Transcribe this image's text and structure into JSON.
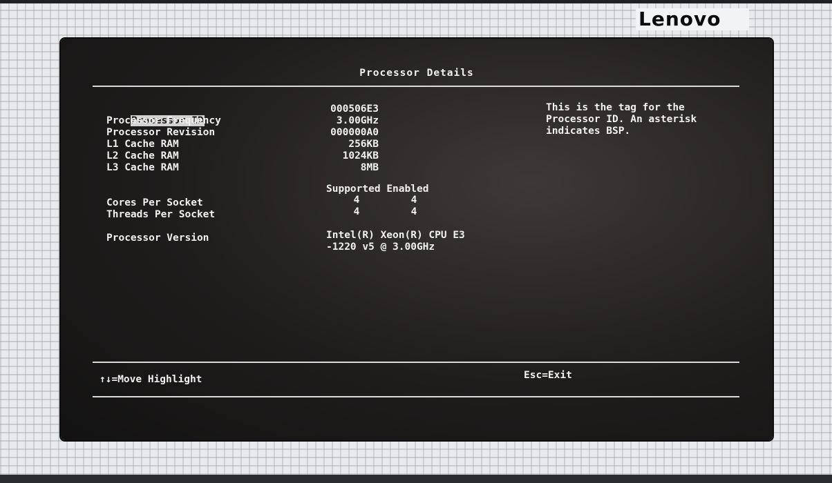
{
  "brand": {
    "logo_text": "Lenovo"
  },
  "screen": {
    "title": "Processor Details",
    "fields": [
      {
        "label": "Processor ID",
        "value": "000506E3"
      },
      {
        "label": "Processor Frequency",
        "value": "3.00GHz"
      },
      {
        "label": "Processor Revision",
        "value": "000000A0"
      },
      {
        "label": "L1 Cache RAM",
        "value": "256KB"
      },
      {
        "label": "L2 Cache RAM",
        "value": "1024KB"
      },
      {
        "label": "L3 Cache RAM",
        "value": "8MB"
      }
    ],
    "counts": {
      "header_supported": "Supported",
      "header_enabled": "Enabled",
      "rows": [
        {
          "label": "Cores Per Socket",
          "supported": "4",
          "enabled": "4"
        },
        {
          "label": "Threads Per Socket",
          "supported": "4",
          "enabled": "4"
        }
      ]
    },
    "version": {
      "label": "Processor Version",
      "line1": "Intel(R) Xeon(R) CPU E3",
      "line2": "-1220 v5 @ 3.00GHz"
    },
    "help_text": "This is the tag for the Processor ID. An asterisk indicates BSP.",
    "footer": {
      "move_arrows": "↑↓",
      "move_label": "=Move Highlight",
      "exit_label": "Esc=Exit"
    }
  },
  "colors": {
    "screen_bg": "#1f1d1c",
    "text": "#f1f1f1",
    "highlight_bg": "#d2d2d2",
    "frame_bg": "#e9eaec"
  }
}
